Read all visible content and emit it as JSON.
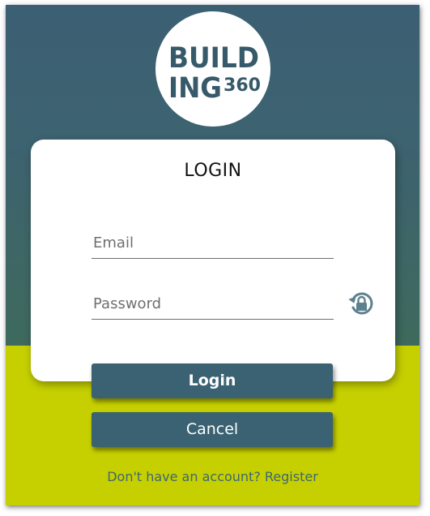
{
  "logo": {
    "line1": "BUILD",
    "line2": "ING",
    "suffix": "360"
  },
  "form": {
    "title": "LOGIN",
    "email_placeholder": "Email",
    "password_placeholder": "Password",
    "reveal_icon": "lock-refresh-icon"
  },
  "buttons": {
    "login_label": "Login",
    "cancel_label": "Cancel"
  },
  "footer": {
    "register_text": "Don't have an account? Register"
  },
  "colors": {
    "header_background": "#3c6073",
    "accent_lime": "#c6d000",
    "button_background": "#3a6272",
    "card_background": "#ffffff"
  }
}
